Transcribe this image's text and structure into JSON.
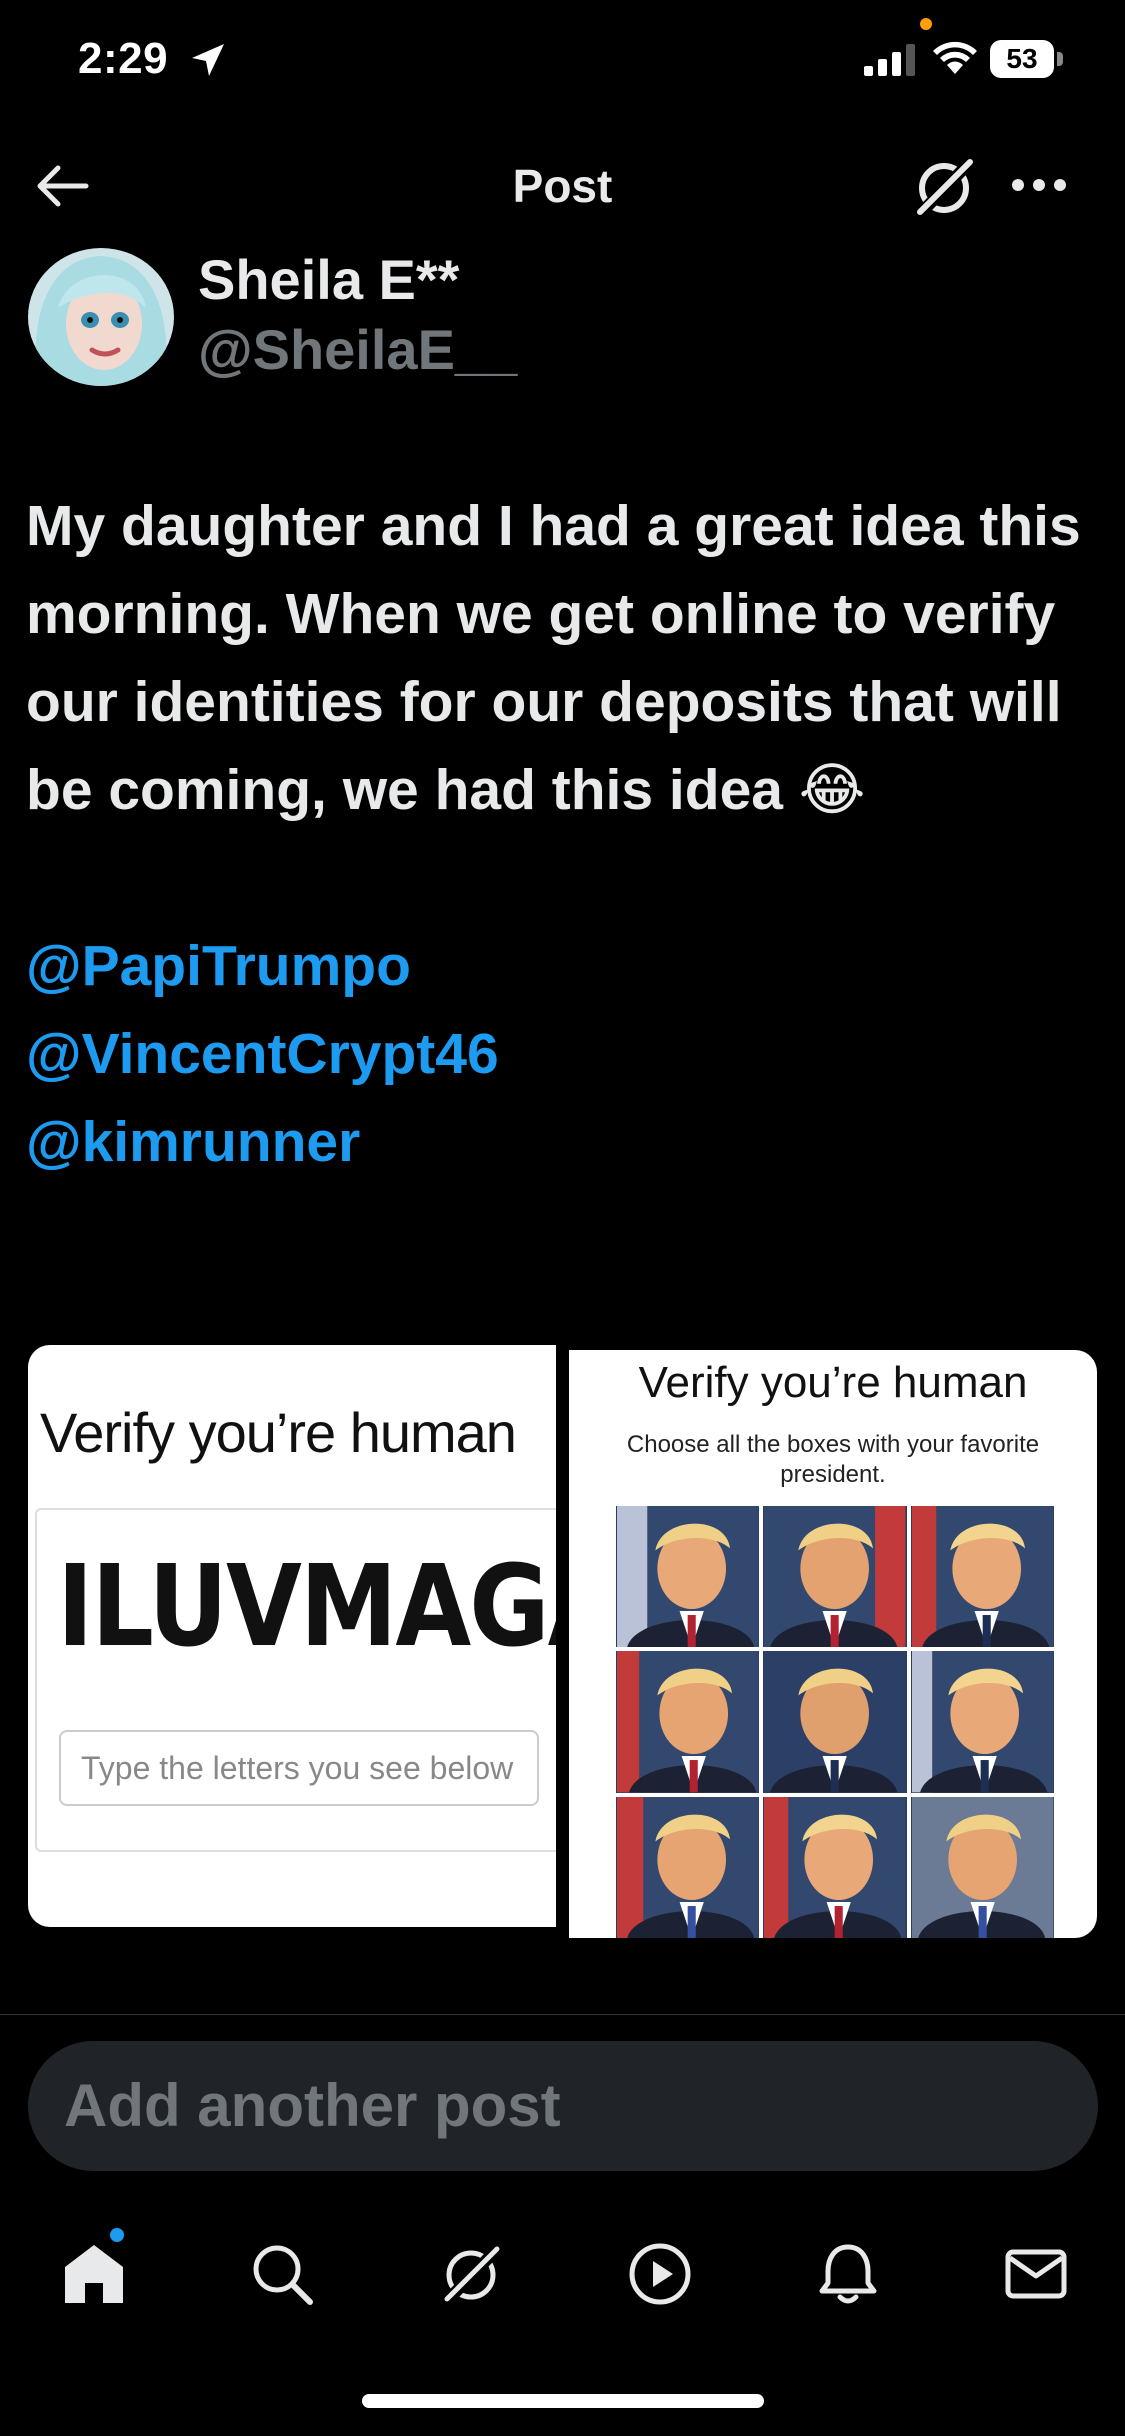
{
  "status_bar": {
    "time": "2:29",
    "battery": "53"
  },
  "header": {
    "title": "Post"
  },
  "post": {
    "author": {
      "name": "Sheila E**",
      "handle": "@SheilaE__"
    },
    "text": "My daughter and I had a great idea this morning. When we get online to verify our identities for our deposits that will be coming, we had this idea 😂",
    "mentions": [
      "@PapiTrumpo",
      "@VincentCrypt46",
      "@kimrunner"
    ],
    "media": {
      "left": {
        "title": "Verify you’re human",
        "captcha_word": "ILUVMAGA",
        "input_placeholder": "Type the letters you see below"
      },
      "right": {
        "title": "Verify you’re human",
        "subtitle": "Choose all the boxes with your favorite president."
      }
    }
  },
  "reply": {
    "placeholder": "Add another post"
  },
  "tabs": [
    "home-icon",
    "search-icon",
    "grok-icon",
    "video-icon",
    "notifications-icon",
    "messages-icon"
  ],
  "colors": {
    "background": "#000000",
    "accent": "#1d9bf0",
    "secondary_text": "#71767b"
  }
}
